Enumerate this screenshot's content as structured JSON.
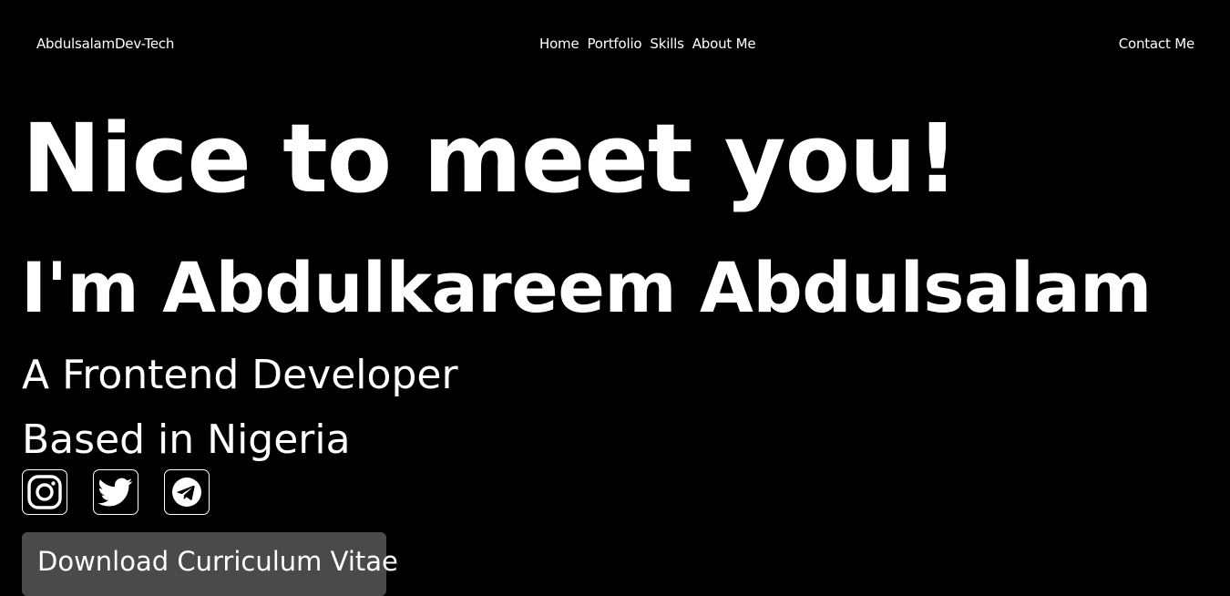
{
  "nav": {
    "brand": "AbdulsalamDev-Tech",
    "links": [
      "Home",
      "Portfolio",
      "Skills",
      "About Me"
    ],
    "contact": "Contact Me"
  },
  "hero": {
    "greeting": "Nice to meet you!",
    "name": "I'm Abdulkareem Abdulsalam",
    "role": "A Frontend Developer",
    "location": "Based in Nigeria"
  },
  "socials": [
    {
      "icon": "instagram-icon"
    },
    {
      "icon": "twitter-icon"
    },
    {
      "icon": "telegram-icon"
    }
  ],
  "cv_button": "Download Curriculum Vitae",
  "colors": {
    "background": "#000000",
    "text": "#ffffff",
    "button_bg": "#4a4a4a"
  }
}
